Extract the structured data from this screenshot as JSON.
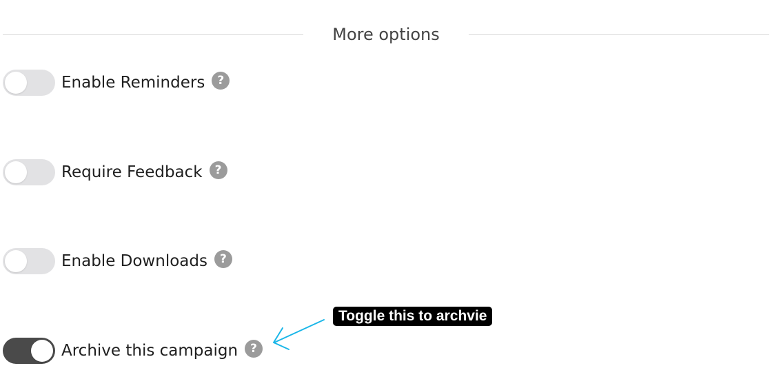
{
  "section": {
    "title": "More options"
  },
  "options": [
    {
      "label": "Enable Reminders",
      "enabled": false,
      "help_icon": "question-circle-icon"
    },
    {
      "label": "Require Feedback",
      "enabled": false,
      "help_icon": "question-circle-icon"
    },
    {
      "label": "Enable Downloads",
      "enabled": false,
      "help_icon": "question-circle-icon"
    },
    {
      "label": "Archive this campaign",
      "enabled": true,
      "help_icon": "question-circle-icon"
    }
  ],
  "help_glyph": "?",
  "annotation": {
    "text": "Toggle this to archvie",
    "arrow_color": "#1ab6e8"
  },
  "colors": {
    "toggle_off": "#e2e2e4",
    "toggle_on": "#4a4a4a",
    "help_icon": "#9b9b9b"
  }
}
